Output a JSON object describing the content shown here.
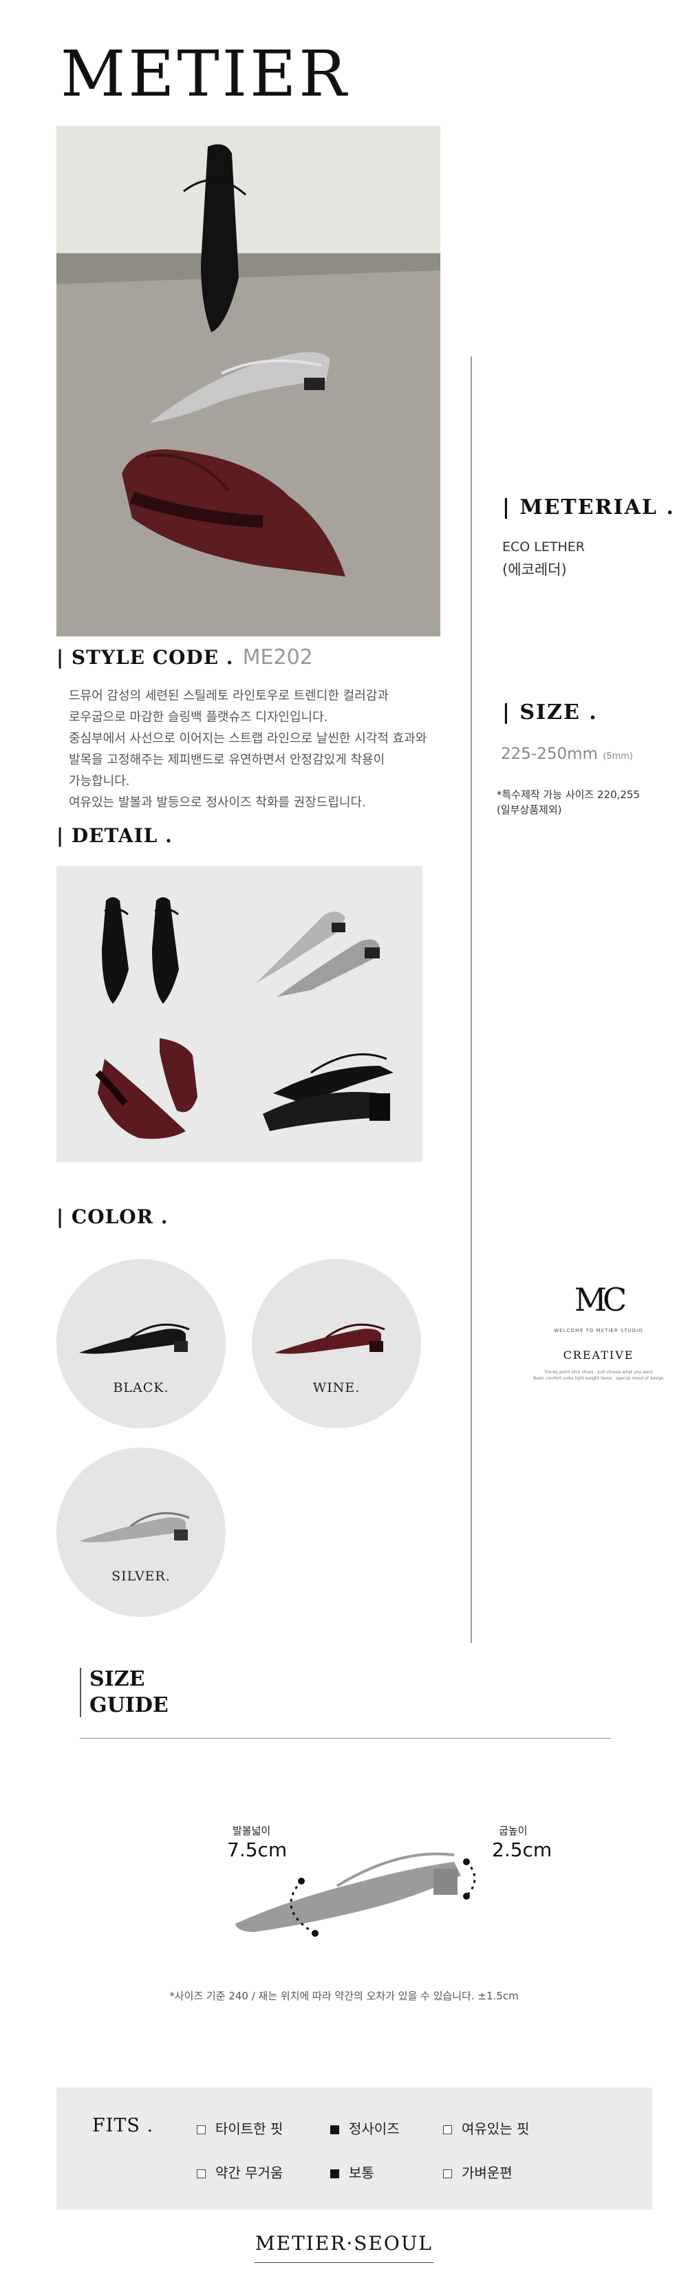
{
  "brand": {
    "logo": "METIER"
  },
  "hero": {
    "alt": "three pointed flat slingback shoes: black, silver, wine"
  },
  "material": {
    "heading": "| METERIAL .",
    "value_en": "ECO LETHER",
    "value_ko": "(에코레더)"
  },
  "size": {
    "heading": "| SIZE .",
    "range": "225-250mm",
    "step": "(5mm)",
    "note_1": "*특수제작 가능 사이즈 220,255",
    "note_2": "(일부상품제외)"
  },
  "style": {
    "heading": "| STYLE CODE .",
    "code": "ME202"
  },
  "description": [
    "드뮤어 감성의 세련된 스틸레토 라인토우로 트렌디한 컬러감과",
    "로우굽으로 마감한 슬링백 플랫슈즈 디자인입니다.",
    "중심부에서 사선으로 이어지는 스트랩 라인으로 날씬한 시각적 효과와",
    "발목을 고정해주는 제피밴드로 유연하면서 안정감있게 착용이",
    "가능합니다.",
    "여유있는 발볼과 발등으로 정사이즈 착화를 권장드립니다."
  ],
  "detail": {
    "heading": "| DETAIL ."
  },
  "color": {
    "heading": "| COLOR .",
    "options": [
      {
        "label": "BLACK.",
        "hex": "#141414"
      },
      {
        "label": "WINE.",
        "hex": "#5e1a1f"
      },
      {
        "label": "SILVER.",
        "hex": "#a9a9a9"
      }
    ]
  },
  "badge": {
    "welcome": "WELCOME TO METIER STUDIO",
    "title": "CREATIVE",
    "small_1": "Trendy point slick shoes · just choose what you want",
    "small_2": "Basic comfort soles light weight items · special mood of design"
  },
  "size_guide": {
    "heading_1": "SIZE",
    "heading_2": "GUIDE",
    "width_label": "발볼넓이",
    "width_value": "7.5cm",
    "heel_label": "굽높이",
    "heel_value": "2.5cm",
    "note": "*사이즈 기준 240 / 재는 위치에 따라 약간의 오차가 있을 수 있습니다. ±1.5cm"
  },
  "fits": {
    "heading": "FITS .",
    "row1": [
      {
        "label": "타이트한 핏",
        "checked": false
      },
      {
        "label": "정사이즈",
        "checked": true
      },
      {
        "label": "여유있는 핏",
        "checked": false
      }
    ],
    "row2": [
      {
        "label": "약간 무거움",
        "checked": false
      },
      {
        "label": "보통",
        "checked": true
      },
      {
        "label": "가벼운편",
        "checked": false
      }
    ]
  },
  "footer": {
    "logo": "METIER·SEOUL"
  }
}
